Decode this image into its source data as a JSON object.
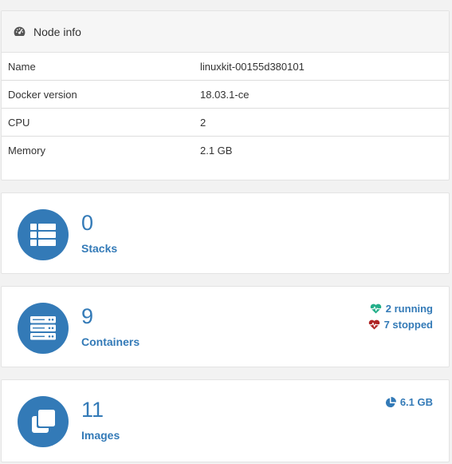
{
  "node_info": {
    "title": "Node info",
    "rows": [
      {
        "key": "Name",
        "value": "linuxkit-00155d380101"
      },
      {
        "key": "Docker version",
        "value": "18.03.1-ce"
      },
      {
        "key": "CPU",
        "value": "2"
      },
      {
        "key": "Memory",
        "value": "2.1 GB"
      }
    ]
  },
  "stacks": {
    "count": "0",
    "label": "Stacks",
    "icon": "list-icon"
  },
  "containers": {
    "count": "9",
    "label": "Containers",
    "icon": "server-icon",
    "running": "2 running",
    "stopped": "7 stopped"
  },
  "images": {
    "count": "11",
    "label": "Images",
    "icon": "clone-icon",
    "size": "6.1 GB"
  },
  "colors": {
    "accent": "#337ab7",
    "running": "#23ae89",
    "stopped": "#ae2323"
  }
}
